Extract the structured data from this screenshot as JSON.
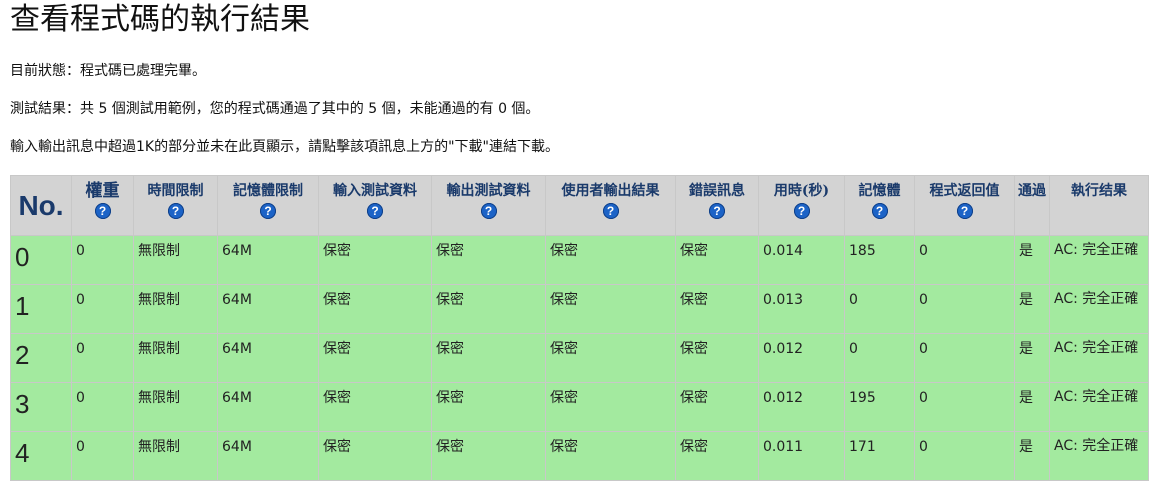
{
  "page_title": "查看程式碼的執行結果",
  "status_line": "目前狀態：程式碼已處理完畢。",
  "result_line": "測試結果：共 5 個測試用範例，您的程式碼通過了其中的 5 個，未能通過的有 0 個。",
  "note_line": "輸入輸出訊息中超過1K的部分並未在此頁顯示，請點擊該項訊息上方的\"下載\"連結下載。",
  "table": {
    "headers": {
      "no": "No.",
      "weight": "權重",
      "time_limit": "時間限制",
      "memory_limit": "記憶體限制",
      "input_data": "輸入測試資料",
      "output_data": "輸出測試資料",
      "user_output": "使用者輸出結果",
      "error_msg": "錯誤訊息",
      "time_used": "用時(秒)",
      "memory": "記憶體",
      "return_value": "程式返回值",
      "passed": "通過",
      "result": "執行结果"
    },
    "help_icon_glyph": "?",
    "rows": [
      {
        "no": "0",
        "weight": "0",
        "time_limit": "無限制",
        "memory_limit": "64M",
        "input_data": "保密",
        "output_data": "保密",
        "user_output": "保密",
        "error_msg": "保密",
        "time_used": "0.014",
        "memory": "185",
        "return_value": "0",
        "passed": "是",
        "result": "AC: 完全正確"
      },
      {
        "no": "1",
        "weight": "0",
        "time_limit": "無限制",
        "memory_limit": "64M",
        "input_data": "保密",
        "output_data": "保密",
        "user_output": "保密",
        "error_msg": "保密",
        "time_used": "0.013",
        "memory": "0",
        "return_value": "0",
        "passed": "是",
        "result": "AC: 完全正確"
      },
      {
        "no": "2",
        "weight": "0",
        "time_limit": "無限制",
        "memory_limit": "64M",
        "input_data": "保密",
        "output_data": "保密",
        "user_output": "保密",
        "error_msg": "保密",
        "time_used": "0.012",
        "memory": "0",
        "return_value": "0",
        "passed": "是",
        "result": "AC: 完全正確"
      },
      {
        "no": "3",
        "weight": "0",
        "time_limit": "無限制",
        "memory_limit": "64M",
        "input_data": "保密",
        "output_data": "保密",
        "user_output": "保密",
        "error_msg": "保密",
        "time_used": "0.012",
        "memory": "195",
        "return_value": "0",
        "passed": "是",
        "result": "AC: 完全正確"
      },
      {
        "no": "4",
        "weight": "0",
        "time_limit": "無限制",
        "memory_limit": "64M",
        "input_data": "保密",
        "output_data": "保密",
        "user_output": "保密",
        "error_msg": "保密",
        "time_used": "0.011",
        "memory": "171",
        "return_value": "0",
        "passed": "是",
        "result": "AC: 完全正確"
      }
    ]
  },
  "colors": {
    "header_bg": "#d3d3d3",
    "header_text": "#1a3a6b",
    "row_bg": "#a3ea9f",
    "help_icon": "#1c63c7"
  }
}
